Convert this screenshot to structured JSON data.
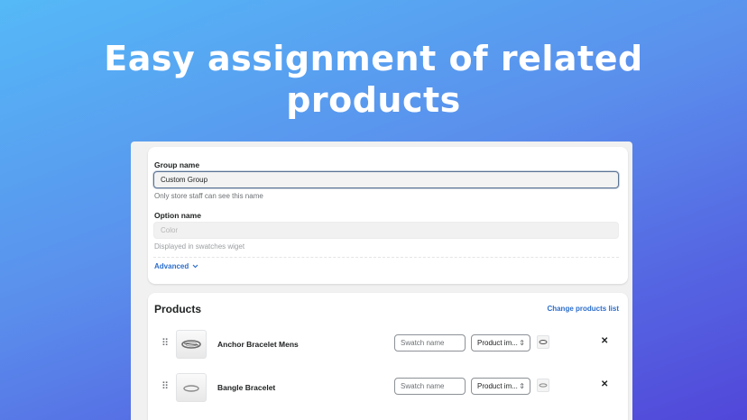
{
  "hero": {
    "line1": "Easy assignment of related",
    "line2": "products"
  },
  "settings": {
    "group_name_label": "Group name",
    "group_name_value": "Custom Group",
    "group_name_hint": "Only store staff can see this name",
    "option_name_label": "Option name",
    "option_name_placeholder": "Color",
    "option_name_hint": "Displayed in swatches wiget",
    "advanced_label": "Advanced"
  },
  "products": {
    "title": "Products",
    "change_link": "Change products list",
    "items": [
      {
        "name": "Anchor Bracelet Mens",
        "swatch_placeholder": "Swatch name",
        "select_value": "Product im...",
        "thumb_icon": "bracelet-image-icon"
      },
      {
        "name": "Bangle Bracelet",
        "swatch_placeholder": "Swatch name",
        "select_value": "Product im...",
        "thumb_icon": "bangle-image-icon"
      }
    ]
  },
  "colors": {
    "accent_link": "#2c6ecb",
    "gradient_start": "#55b9f7",
    "gradient_end": "#5147d9"
  }
}
